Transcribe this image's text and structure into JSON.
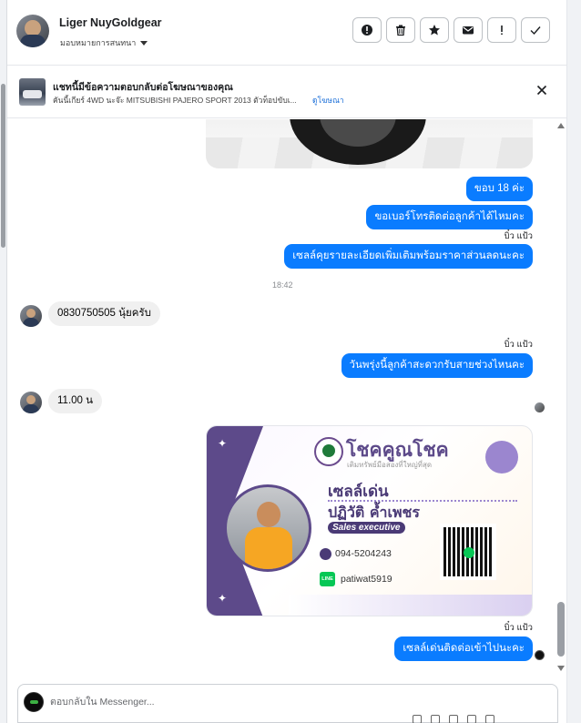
{
  "header": {
    "contact_name": "Liger NuyGoldgear",
    "assign_label": "มอบหมายการสนทนา",
    "toolbar": [
      {
        "name": "report-button",
        "icon": "alert-circle-icon"
      },
      {
        "name": "delete-button",
        "icon": "trash-icon"
      },
      {
        "name": "star-button",
        "icon": "star-icon"
      },
      {
        "name": "mark-unread-button",
        "icon": "envelope-icon"
      },
      {
        "name": "spam-button",
        "icon": "exclamation-icon"
      },
      {
        "name": "done-button",
        "icon": "check-icon"
      }
    ]
  },
  "ad_banner": {
    "title": "แชทนี้มีข้อความตอบกลับต่อโฆษณาของคุณ",
    "subtitle": "คันนี้เกียร์ 4WD นะจ๊ะ MITSUBISHI PAJERO SPORT 2013 ตัวท็อปขับเ...",
    "link": "ดูโฆษณา"
  },
  "messages": {
    "m1": "ขอบ 18 ค่ะ",
    "m2": "ขอเบอร์โทรติดต่อลูกค้าได้ไหมคะ",
    "sender1": "บิ๋ว แป้ว",
    "m3": "เซลล์คุยรายละเอียดเพิ่มเติมพร้อมราคาส่วนลดนะคะ",
    "time1": "18:42",
    "in1": "0830750505 นุ้ยครับ",
    "sender2": "บิ๋ว แป้ว",
    "m4": "วันพรุ่งนี้ลูกค้าสะดวกรับสายช่วงไหนคะ",
    "in2": "11.00 น",
    "sender3": "บิ๋ว แป้ว",
    "m5": "เซลล์เด่นติดต่อเข้าไปนะคะ"
  },
  "business_card": {
    "brand": "โชคคูณโชค",
    "slogan": "เติมทรัพย์มือสองที่ใหญ่ที่สุด",
    "name_line1": "เซลล์เด่น",
    "name_line2": "ปฏิวัติ ค้ำเพชร",
    "role": "Sales executive",
    "phone": "094-5204243",
    "line_label": "LINE",
    "line_id": "patiwat5919"
  },
  "composer": {
    "placeholder": "ตอบกลับใน Messenger..."
  },
  "colors": {
    "outgoing_bubble": "#0a7cff",
    "incoming_bubble": "#f0f0f0",
    "card_purple": "#5d4a8a",
    "link_blue": "#1a6ed8"
  }
}
